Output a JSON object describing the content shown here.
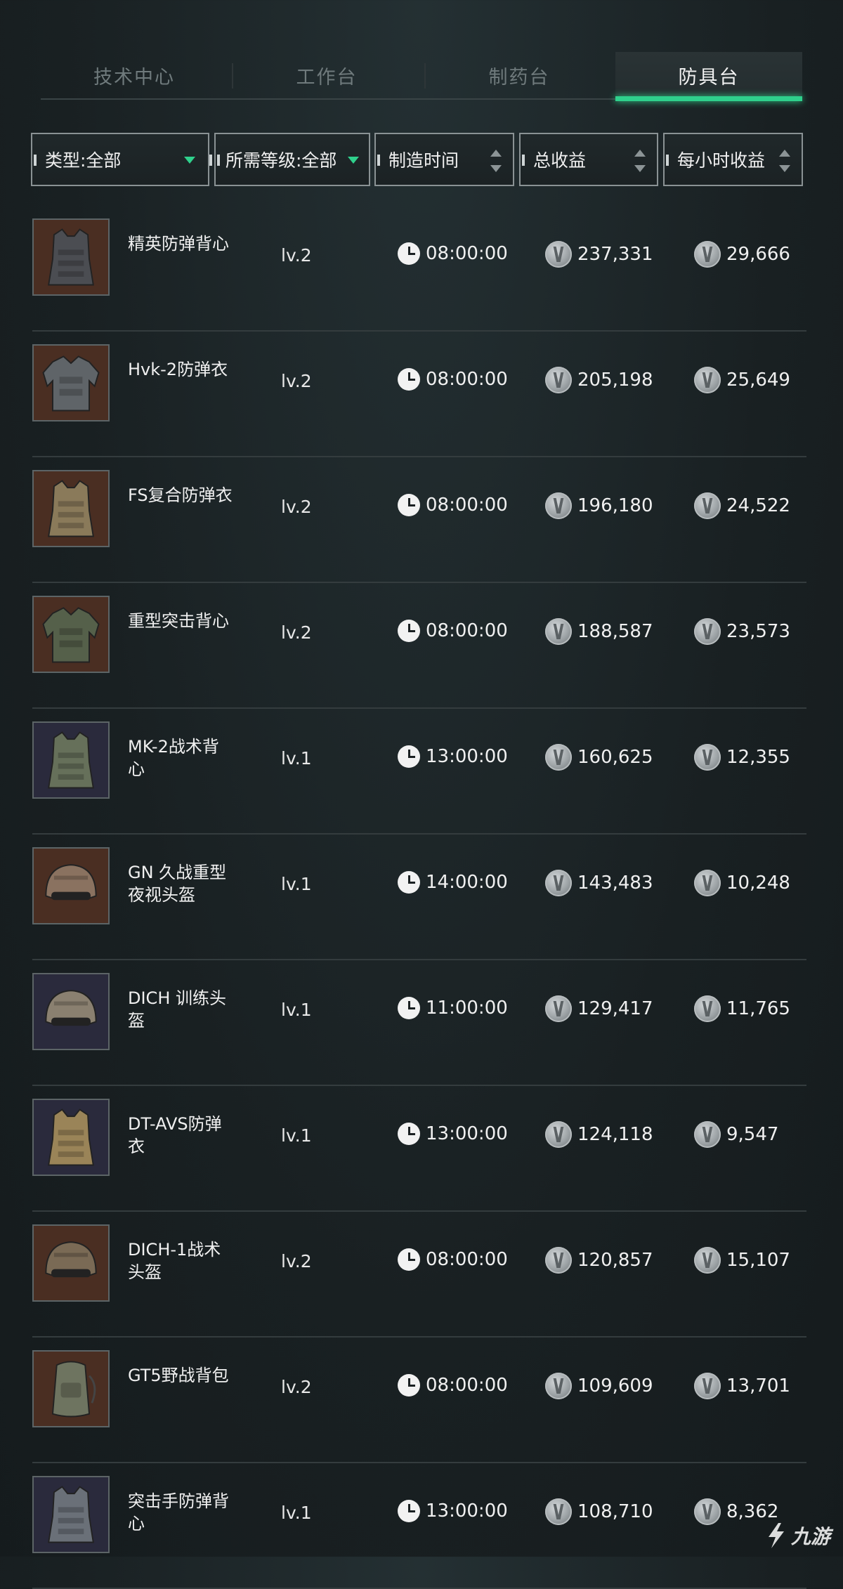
{
  "tabs": [
    {
      "label": "技术中心",
      "active": false
    },
    {
      "label": "工作台",
      "active": false
    },
    {
      "label": "制药台",
      "active": false
    },
    {
      "label": "防具台",
      "active": true
    }
  ],
  "filters": {
    "type": "类型:全部",
    "level": "所需等级:全部",
    "craft_time": "制造时间",
    "total_income": "总收益",
    "hourly_income": "每小时收益"
  },
  "colors": {
    "accent": "#2fd08c",
    "background": "#1a2022"
  },
  "icons": {
    "time": "clock-icon",
    "currency": "coin-icon",
    "filter_open": "triangle-down-icon",
    "sort": "sort-arrows-icon"
  },
  "items": [
    {
      "name": "精英防弹背心",
      "level": "lv.2",
      "time": "08:00:00",
      "total": "237,331",
      "hourly": "29,666",
      "kind": "vest",
      "bg": "#4a2e22",
      "tint": "#4b4d52"
    },
    {
      "name": "Hvk-2防弹衣",
      "level": "lv.2",
      "time": "08:00:00",
      "total": "205,198",
      "hourly": "25,649",
      "kind": "armor",
      "bg": "#4a2e22",
      "tint": "#5f6468"
    },
    {
      "name": "FS复合防弹衣",
      "level": "lv.2",
      "time": "08:00:00",
      "total": "196,180",
      "hourly": "24,522",
      "kind": "vest",
      "bg": "#4a2e22",
      "tint": "#8a7a5a"
    },
    {
      "name": "重型突击背心",
      "level": "lv.2",
      "time": "08:00:00",
      "total": "188,587",
      "hourly": "23,573",
      "kind": "armor",
      "bg": "#4a2e22",
      "tint": "#55604a"
    },
    {
      "name": "MK-2战术背心",
      "level": "lv.1",
      "time": "13:00:00",
      "total": "160,625",
      "hourly": "12,355",
      "kind": "vest",
      "bg": "#2a2a3c",
      "tint": "#66705a"
    },
    {
      "name": "GN 久战重型夜视头盔",
      "level": "lv.1",
      "time": "14:00:00",
      "total": "143,483",
      "hourly": "10,248",
      "kind": "helmet",
      "bg": "#4a2e22",
      "tint": "#8a7260"
    },
    {
      "name": "DICH 训练头盔",
      "level": "lv.1",
      "time": "11:00:00",
      "total": "129,417",
      "hourly": "11,765",
      "kind": "helmet",
      "bg": "#2a2a3c",
      "tint": "#8a8070"
    },
    {
      "name": "DT-AVS防弹衣",
      "level": "lv.1",
      "time": "13:00:00",
      "total": "124,118",
      "hourly": "9,547",
      "kind": "vest",
      "bg": "#2a2a3c",
      "tint": "#9a8458"
    },
    {
      "name": "DICH-1战术头盔",
      "level": "lv.2",
      "time": "08:00:00",
      "total": "120,857",
      "hourly": "15,107",
      "kind": "helmet",
      "bg": "#4a2e22",
      "tint": "#7a6a55"
    },
    {
      "name": "GT5野战背包",
      "level": "lv.2",
      "time": "08:00:00",
      "total": "109,609",
      "hourly": "13,701",
      "kind": "backpack",
      "bg": "#4a2e22",
      "tint": "#6e7460"
    },
    {
      "name": "突击手防弹背心",
      "level": "lv.1",
      "time": "13:00:00",
      "total": "108,710",
      "hourly": "8,362",
      "kind": "vest",
      "bg": "#2a2a3c",
      "tint": "#6a7078"
    }
  ],
  "watermark": {
    "text": "九游"
  }
}
